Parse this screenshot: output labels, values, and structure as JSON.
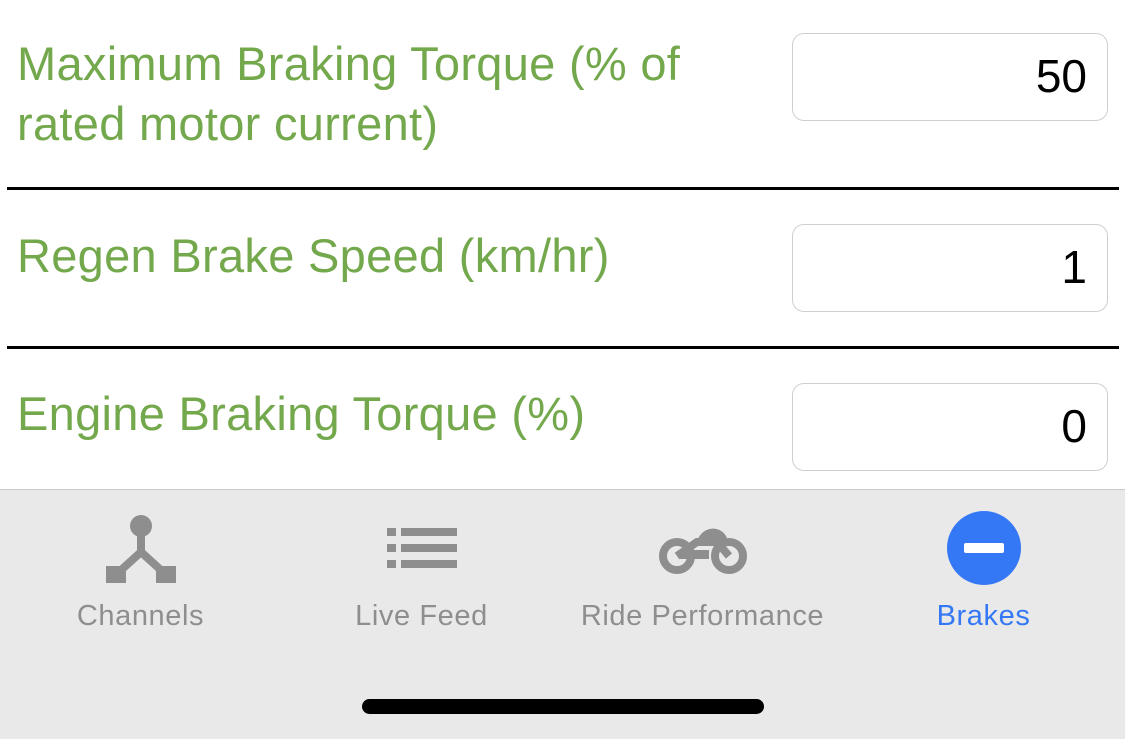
{
  "settings": {
    "rows": [
      {
        "label_line1": "Maximum Braking Torque (% of",
        "label_line2": "rated motor current)",
        "value": "50"
      },
      {
        "label_line1": "Regen Brake Speed (km/hr)",
        "value": "1"
      },
      {
        "label_line1": "Engine Braking Torque (%)",
        "value": "0"
      }
    ],
    "label_color": "#74a84d"
  },
  "tabbar": {
    "tabs": [
      {
        "label": "Channels",
        "icon": "channels-icon",
        "active": false
      },
      {
        "label": "Live Feed",
        "icon": "list-icon",
        "active": false
      },
      {
        "label": "Ride Performance",
        "icon": "motorcycle-icon",
        "active": false
      },
      {
        "label": "Brakes",
        "icon": "minus-circle-icon",
        "active": true
      }
    ],
    "active_color": "#3478f6",
    "inactive_color": "#8e8e8e"
  }
}
